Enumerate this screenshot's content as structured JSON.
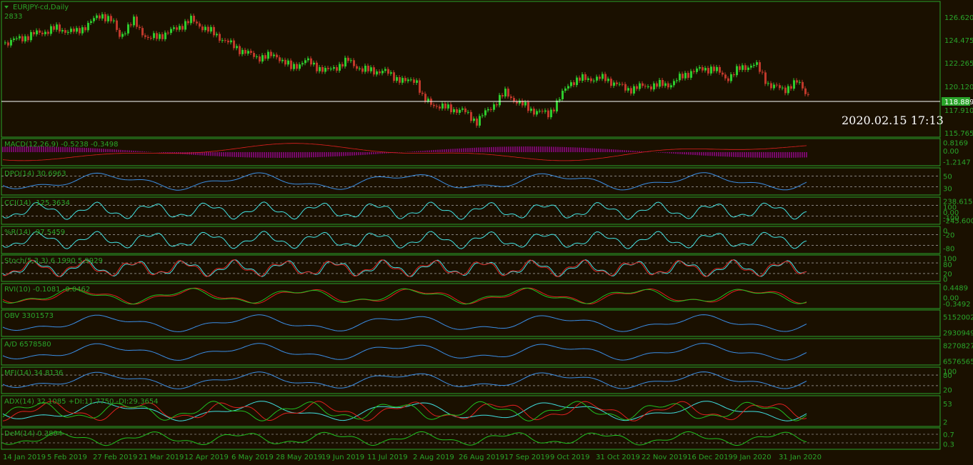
{
  "app": {
    "symbol_title": "EURJPY-cd,Daily",
    "tick_count": "2833",
    "timestamp": "2020.02.15 17:13",
    "current_price": "118.889"
  },
  "colors": {
    "background": "#1a1000",
    "grid_border": "#2aa52a",
    "text": "#2aa52a",
    "bull_candle": "#2ecc2e",
    "bear_candle": "#c0392b",
    "macd_hist": "#d400d4",
    "blue_line": "#3a8ee6",
    "cyan_line": "#40e0e0",
    "red_line": "#e02020",
    "green_line": "#20c020",
    "level_line": "#ffffff"
  },
  "price_axis": [
    "126.620",
    "124.475",
    "122.265",
    "120.120",
    "117.910",
    "115.765"
  ],
  "date_axis": [
    "14 Jan 2019",
    "5 Feb 2019",
    "27 Feb 2019",
    "21 Mar 2019",
    "12 Apr 2019",
    "6 May 2019",
    "28 May 2019",
    "19 Jun 2019",
    "11 Jul 2019",
    "2 Aug 2019",
    "26 Aug 2019",
    "17 Sep 2019",
    "9 Oct 2019",
    "31 Oct 2019",
    "22 Nov 2019",
    "16 Dec 2019",
    "9 Jan 2020",
    "31 Jan 2020"
  ],
  "indicators": [
    {
      "id": "macd",
      "label": "MACD(12,26,9) -0.5238 -0.3498",
      "axis": [
        "0.8169",
        "0.00",
        "-1.2147"
      ]
    },
    {
      "id": "dpo",
      "label": "DPO(14) 30.6963",
      "axis": [
        "50",
        "30"
      ]
    },
    {
      "id": "cci",
      "label": "CCI(14) -125.3634",
      "axis": [
        "238.6153",
        "100",
        "0.00",
        "-100",
        "-245.6005"
      ]
    },
    {
      "id": "wpr",
      "label": "%R(14) -97.5459",
      "axis": [
        "0",
        "-20",
        "-80"
      ]
    },
    {
      "id": "stoch",
      "label": "Stoch(5,3,3) 6.1990 5.9929",
      "axis": [
        "100",
        "80",
        "20",
        "0"
      ]
    },
    {
      "id": "rvi",
      "label": "RVI(10) -0.1081 -0.0462",
      "axis": [
        "0.4489",
        "0.00",
        "-0.3492"
      ]
    },
    {
      "id": "obv",
      "label": "OBV 3301573",
      "axis": [
        "5152002",
        "2930949"
      ]
    },
    {
      "id": "ad",
      "label": "A/D 6578580",
      "axis": [
        "8270827",
        "6576565"
      ]
    },
    {
      "id": "mfi",
      "label": "MFI(14) 34.8136",
      "axis": [
        "100",
        "80",
        "20"
      ]
    },
    {
      "id": "adx",
      "label": "ADX(14) 32.1085 +DI:11.7750 -DI:29.3654",
      "axis": [
        "53",
        "2"
      ]
    },
    {
      "id": "demarker",
      "label": "DeM(14) 0.3894",
      "axis": [
        "0.7",
        "0.3"
      ]
    }
  ]
}
